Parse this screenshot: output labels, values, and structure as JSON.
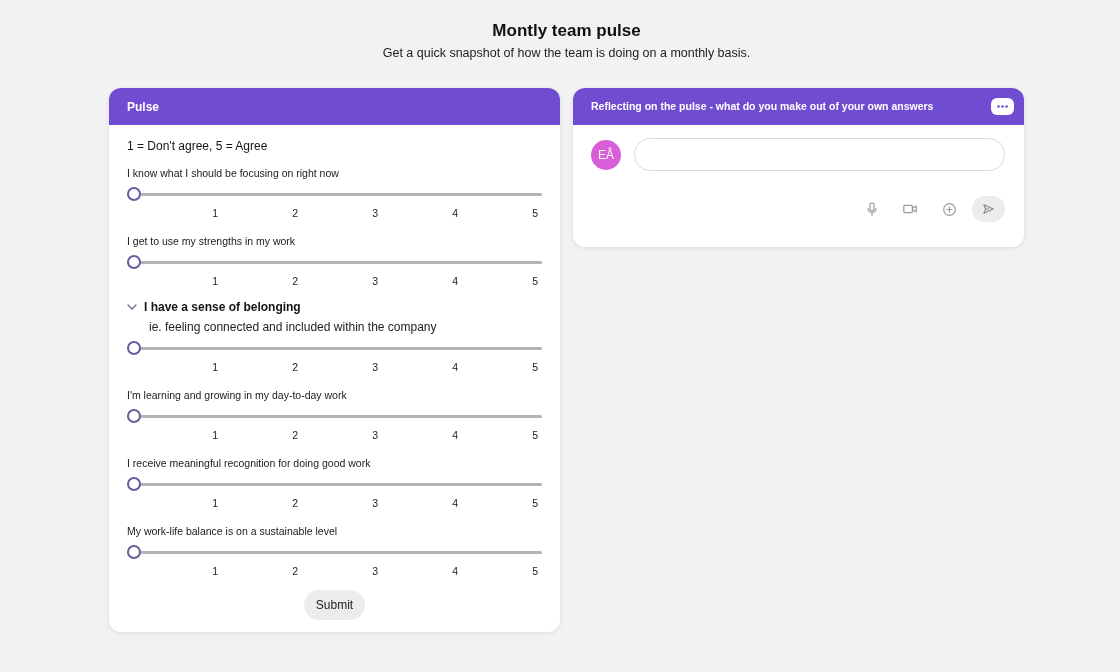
{
  "page": {
    "title": "Montly team pulse",
    "subtitle": "Get a quick snapshot of how the team is doing on a monthly basis."
  },
  "pulse_card": {
    "title": "Pulse",
    "scale_note": "1 = Don't agree, 5 = Agree",
    "questions": [
      {
        "kind": "plain",
        "label": "I know what I should be focusing on right now",
        "level": 0,
        "ticks": [
          "1",
          "2",
          "3",
          "4",
          "5"
        ]
      },
      {
        "kind": "plain",
        "label": "I get to use my strengths in my work",
        "level": 0,
        "ticks": [
          "1",
          "2",
          "3",
          "4",
          "5"
        ]
      },
      {
        "kind": "expandable",
        "label": "I have a sense of belonging",
        "expanded": true,
        "description": "ie. feeling connected and included within the company",
        "level": 0,
        "ticks": [
          "1",
          "2",
          "3",
          "4",
          "5"
        ]
      },
      {
        "kind": "plain",
        "label": "I'm learning and growing in my day-to-day work",
        "level": 0,
        "ticks": [
          "1",
          "2",
          "3",
          "4",
          "5"
        ]
      },
      {
        "kind": "plain",
        "label": "I receive meaningful recognition for doing good work",
        "level": 0,
        "ticks": [
          "1",
          "2",
          "3",
          "4",
          "5"
        ]
      },
      {
        "kind": "plain",
        "label": "My work-life balance is on a sustainable level",
        "level": 0,
        "ticks": [
          "1",
          "2",
          "3",
          "4",
          "5"
        ]
      }
    ],
    "submit_button": "Submit"
  },
  "reflection_card": {
    "title": "Reflecting on the pulse - what do you make out of your own answers",
    "avatar_initials": "EÅ"
  }
}
